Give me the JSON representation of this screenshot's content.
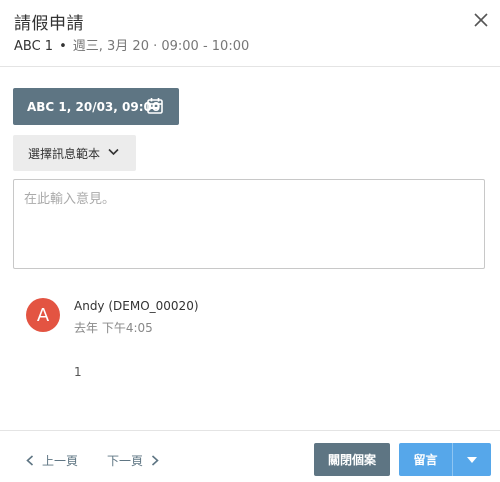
{
  "dialog": {
    "title": "請假申請",
    "subtitle_name": "ABC 1",
    "subtitle_sep": "•",
    "subtitle_schedule": "週三, 3月 20 · 09:00 - 10:00",
    "close_icon": "close-icon"
  },
  "form": {
    "date_button_label": "ABC 1, 20/03, 09:00",
    "date_icon": "calendar-icon",
    "template_button_label": "選擇訊息範本",
    "template_icon": "chevron-down-icon",
    "comment_placeholder": "在此輸入意見。",
    "comment_value": ""
  },
  "comment_item": {
    "avatar_letter": "A",
    "avatar_color": "#e35442",
    "author": "Andy (DEMO_00020)",
    "time": "去年 下午4:05",
    "text": "1"
  },
  "footer": {
    "prev_label": "上一頁",
    "next_label": "下一頁",
    "close_case_label": "關閉個案",
    "comment_label": "留言"
  },
  "colors": {
    "primary_slate": "#5e7583",
    "accent_blue": "#56a7ea"
  }
}
